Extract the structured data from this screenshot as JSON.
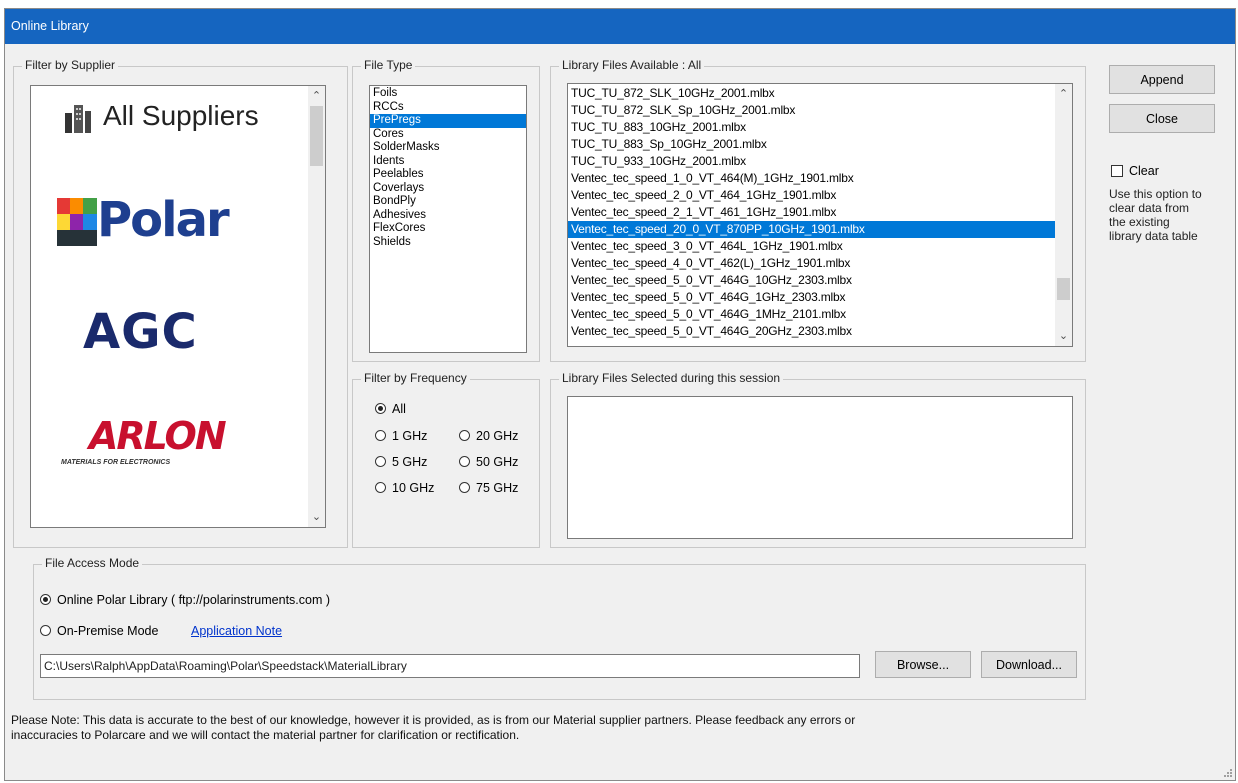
{
  "window": {
    "title": "Online Library"
  },
  "supplier": {
    "legend": "Filter by Supplier",
    "items": [
      {
        "name": "All Suppliers"
      },
      {
        "name": "Polar"
      },
      {
        "name": "AGC"
      },
      {
        "name": "ARLON",
        "tagline": "MATERIALS FOR ELECTRONICS"
      }
    ]
  },
  "file_type": {
    "legend": "File Type",
    "items": [
      "Foils",
      "RCCs",
      "PrePregs",
      "Cores",
      "SolderMasks",
      "Idents",
      "Peelables",
      "Coverlays",
      "BondPly",
      "Adhesives",
      "FlexCores",
      "Shields"
    ],
    "selected": "PrePregs"
  },
  "library_files": {
    "legend": "Library Files Available : All",
    "items": [
      "TUC_TU_872_SLK_10GHz_2001.mlbx",
      "TUC_TU_872_SLK_Sp_10GHz_2001.mlbx",
      "TUC_TU_883_10GHz_2001.mlbx",
      "TUC_TU_883_Sp_10GHz_2001.mlbx",
      "TUC_TU_933_10GHz_2001.mlbx",
      "Ventec_tec_speed_1_0_VT_464(M)_1GHz_1901.mlbx",
      "Ventec_tec_speed_2_0_VT_464_1GHz_1901.mlbx",
      "Ventec_tec_speed_2_1_VT_461_1GHz_1901.mlbx",
      "Ventec_tec_speed_20_0_VT_870PP_10GHz_1901.mlbx",
      "Ventec_tec_speed_3_0_VT_464L_1GHz_1901.mlbx",
      "Ventec_tec_speed_4_0_VT_462(L)_1GHz_1901.mlbx",
      "Ventec_tec_speed_5_0_VT_464G_10GHz_2303.mlbx",
      "Ventec_tec_speed_5_0_VT_464G_1GHz_2303.mlbx",
      "Ventec_tec_speed_5_0_VT_464G_1MHz_2101.mlbx",
      "Ventec_tec_speed_5_0_VT_464G_20GHz_2303.mlbx"
    ],
    "selected_index": 8
  },
  "frequency": {
    "legend": "Filter by Frequency",
    "options": [
      "All",
      "1 GHz",
      "20 GHz",
      "5 GHz",
      "50 GHz",
      "10 GHz",
      "75 GHz"
    ],
    "selected": "All"
  },
  "selected_files": {
    "legend": "Library Files Selected during this session",
    "items": []
  },
  "buttons": {
    "append": "Append",
    "close": "Close",
    "browse": "Browse...",
    "download": "Download..."
  },
  "clear": {
    "label": "Clear",
    "checked": false,
    "help_lines": [
      "Use this option to",
      "clear data from",
      "the existing",
      "library data table"
    ]
  },
  "access_mode": {
    "legend": "File Access Mode",
    "online_label": "Online Polar Library ( ftp://polarinstruments.com )",
    "onpremise_label": "On-Premise Mode",
    "app_note_link": "Application Note",
    "selected": "online",
    "path": "C:\\Users\\Ralph\\AppData\\Roaming\\Polar\\Speedstack\\MaterialLibrary"
  },
  "note": {
    "line1": "Please Note:  This data is accurate to the best of our knowledge, however it is provided, as is from our Material supplier partners.  Please feedback any errors or",
    "line2": "inaccuracies to Polarcare and we will contact the material partner for clarification or rectification."
  },
  "colors": {
    "titlebar": "#1565c0",
    "selection": "#0078d7",
    "agc": "#1a2a6c",
    "arlon": "#c8102e"
  }
}
